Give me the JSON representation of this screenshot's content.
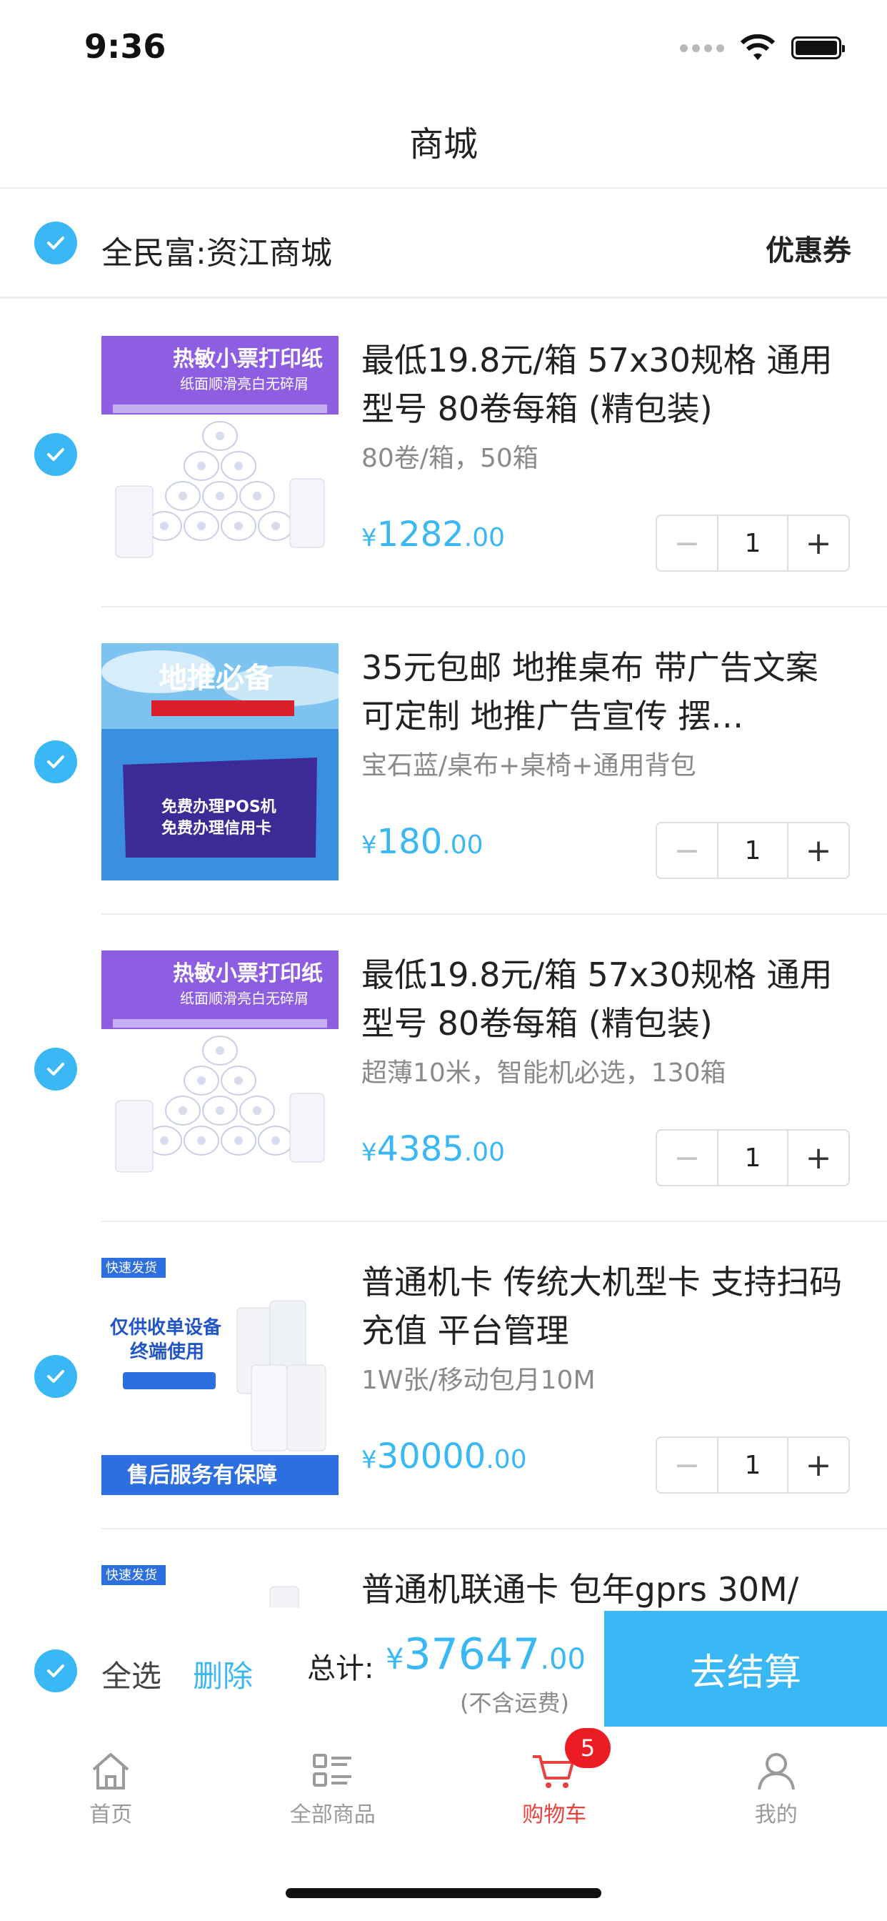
{
  "status_bar": {
    "time": "9:36"
  },
  "nav": {
    "title": "商城"
  },
  "store": {
    "name": "全民富:资江商城",
    "coupon_label": "优惠券"
  },
  "items": [
    {
      "title": "最低19.8元/箱 57x30规格 通用型号 80卷每箱 (精包装)",
      "spec": "80卷/箱，50箱",
      "price_yen": "¥",
      "price_int": "1282",
      "price_dec": ".00",
      "qty": "1",
      "thumb": {
        "kind": "paper",
        "headline": "热敏小票打印纸",
        "sub": "纸面顺滑亮白无碎屑"
      }
    },
    {
      "title": "35元包邮 地推桌布 带广告文案 可定制 地推广告宣传 摆…",
      "spec": "宝石蓝/桌布+桌椅+通用背包",
      "price_yen": "¥",
      "price_int": "180",
      "price_dec": ".00",
      "qty": "1",
      "thumb": {
        "kind": "tablecloth",
        "headline": "地推必备",
        "line1": "免费办理POS机",
        "line2": "免费办理信用卡"
      }
    },
    {
      "title": "最低19.8元/箱 57x30规格 通用型号 80卷每箱 (精包装)",
      "spec": "超薄10米，智能机必选，130箱",
      "price_yen": "¥",
      "price_int": "4385",
      "price_dec": ".00",
      "qty": "1",
      "thumb": {
        "kind": "paper",
        "headline": "热敏小票打印纸",
        "sub": "纸面顺滑亮白无碎屑"
      }
    },
    {
      "title": "普通机卡 传统大机型卡 支持扫码充值 平台管理",
      "spec": "1W张/移动包月10M",
      "price_yen": "¥",
      "price_int": "30000",
      "price_dec": ".00",
      "qty": "1",
      "thumb": {
        "kind": "rolls",
        "tag": "快速发货",
        "line1": "仅供收单设备",
        "line2": "终端使用",
        "footer": "售后服务有保障"
      }
    },
    {
      "title": "普通机联通卡 包年gprs 30M/",
      "spec": "",
      "price_yen": "",
      "price_int": "",
      "price_dec": "",
      "qty": "",
      "thumb": {
        "kind": "rolls-partial",
        "tag": "快速发货"
      }
    }
  ],
  "checkout": {
    "select_all": "全选",
    "delete": "删除",
    "total_label": "总计:",
    "total_yen": "¥",
    "total_int": "37647",
    "total_dec": ".00",
    "shipping_note": "(不含运费)",
    "button": "去结算"
  },
  "tabs": [
    {
      "label": "首页",
      "icon": "home-icon"
    },
    {
      "label": "全部商品",
      "icon": "list-icon"
    },
    {
      "label": "购物车",
      "icon": "cart-icon",
      "badge": "5",
      "active": true
    },
    {
      "label": "我的",
      "icon": "user-icon"
    }
  ],
  "colors": {
    "accent": "#3ab8f6",
    "active_tab": "#e8413e",
    "badge": "#ec1c24"
  }
}
